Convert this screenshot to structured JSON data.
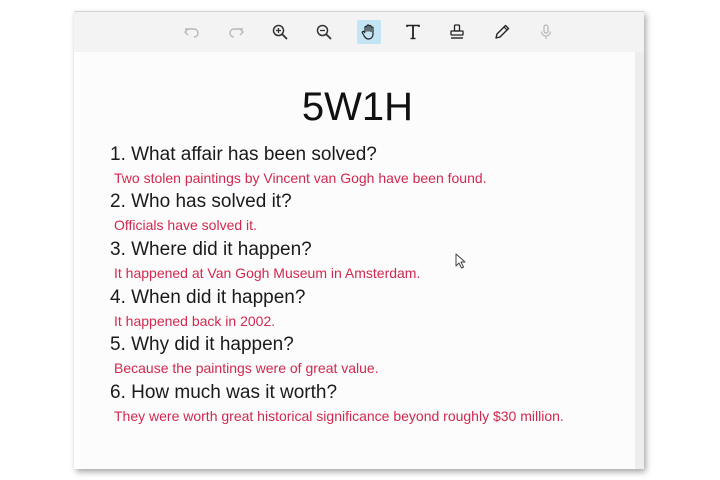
{
  "colors": {
    "question": "#1a1a1a",
    "answer": "#d1284f",
    "toolbar_bg": "#f3f3f3",
    "active_tool_bg": "#c2e4f5"
  },
  "toolbar": {
    "tools": [
      {
        "icon": "undo-icon",
        "state": "disabled"
      },
      {
        "icon": "redo-icon",
        "state": "disabled"
      },
      {
        "icon": "zoom-in-icon",
        "state": "enabled"
      },
      {
        "icon": "zoom-out-icon",
        "state": "enabled"
      },
      {
        "icon": "hand-pan-icon",
        "state": "active"
      },
      {
        "icon": "text-tool-icon",
        "state": "enabled"
      },
      {
        "icon": "stamp-icon",
        "state": "enabled"
      },
      {
        "icon": "pencil-icon",
        "state": "enabled"
      },
      {
        "icon": "microphone-icon",
        "state": "disabled"
      }
    ]
  },
  "document": {
    "title": "5W1H",
    "items": [
      {
        "question": "1. What affair has been solved?",
        "answer": "Two stolen paintings by Vincent van Gogh have been found."
      },
      {
        "question": "2. Who has solved it?",
        "answer": "Officials have solved it."
      },
      {
        "question": "3. Where did it happen?",
        "answer": "It happened at Van Gogh Museum in Amsterdam."
      },
      {
        "question": "4. When did it happen?",
        "answer": "It happened back in 2002."
      },
      {
        "question": "5. Why did it happen?",
        "answer": "Because the paintings were of great value."
      },
      {
        "question": "6. How much was it worth?",
        "answer": "They were worth great historical significance beyond roughly $30 million."
      }
    ]
  }
}
